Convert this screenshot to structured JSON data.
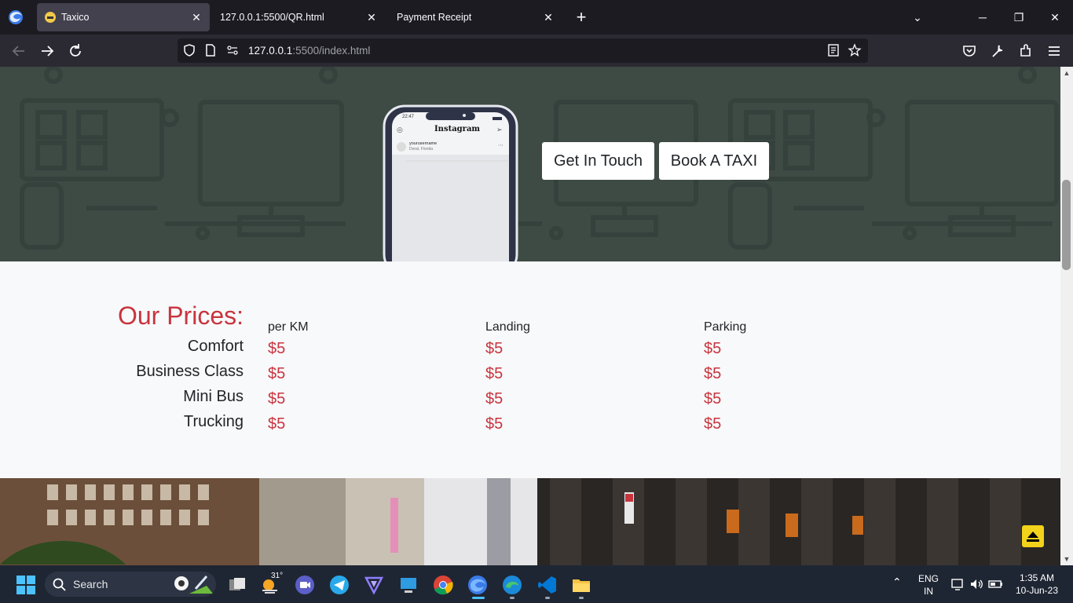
{
  "browser": {
    "tabs": [
      {
        "title": "Taxico",
        "active": true
      },
      {
        "title": "127.0.0.1:5500/QR.html",
        "active": false
      },
      {
        "title": "Payment Receipt",
        "active": false
      }
    ],
    "url_host": "127.0.0.1",
    "url_rest": ":5500/index.html"
  },
  "hero": {
    "buttons": {
      "get_in_touch": "Get In Touch",
      "book_taxi": "Book A TAXI"
    },
    "phone": {
      "time": "22:47",
      "app_title": "Instagram",
      "username": "yourusername",
      "location": "Doral, Florida"
    }
  },
  "prices": {
    "title": "Our Prices:",
    "columns": [
      "per KM",
      "Landing",
      "Parking"
    ],
    "rows": [
      {
        "label": "Comfort",
        "values": [
          "$5",
          "$5",
          "$5"
        ]
      },
      {
        "label": "Business Class",
        "values": [
          "$5",
          "$5",
          "$5"
        ]
      },
      {
        "label": "Mini Bus",
        "values": [
          "$5",
          "$5",
          "$5"
        ]
      },
      {
        "label": "Trucking",
        "values": [
          "$5",
          "$5",
          "$5"
        ]
      }
    ]
  },
  "taskbar": {
    "search_label": "Search",
    "weather_temp": "31°",
    "language": "ENG",
    "region": "IN",
    "time": "1:35 AM",
    "date": "10-Jun-23"
  },
  "colors": {
    "accent_red": "#c8343e",
    "hero_bg": "#3e4b45",
    "back_to_top": "#f2d21a"
  }
}
